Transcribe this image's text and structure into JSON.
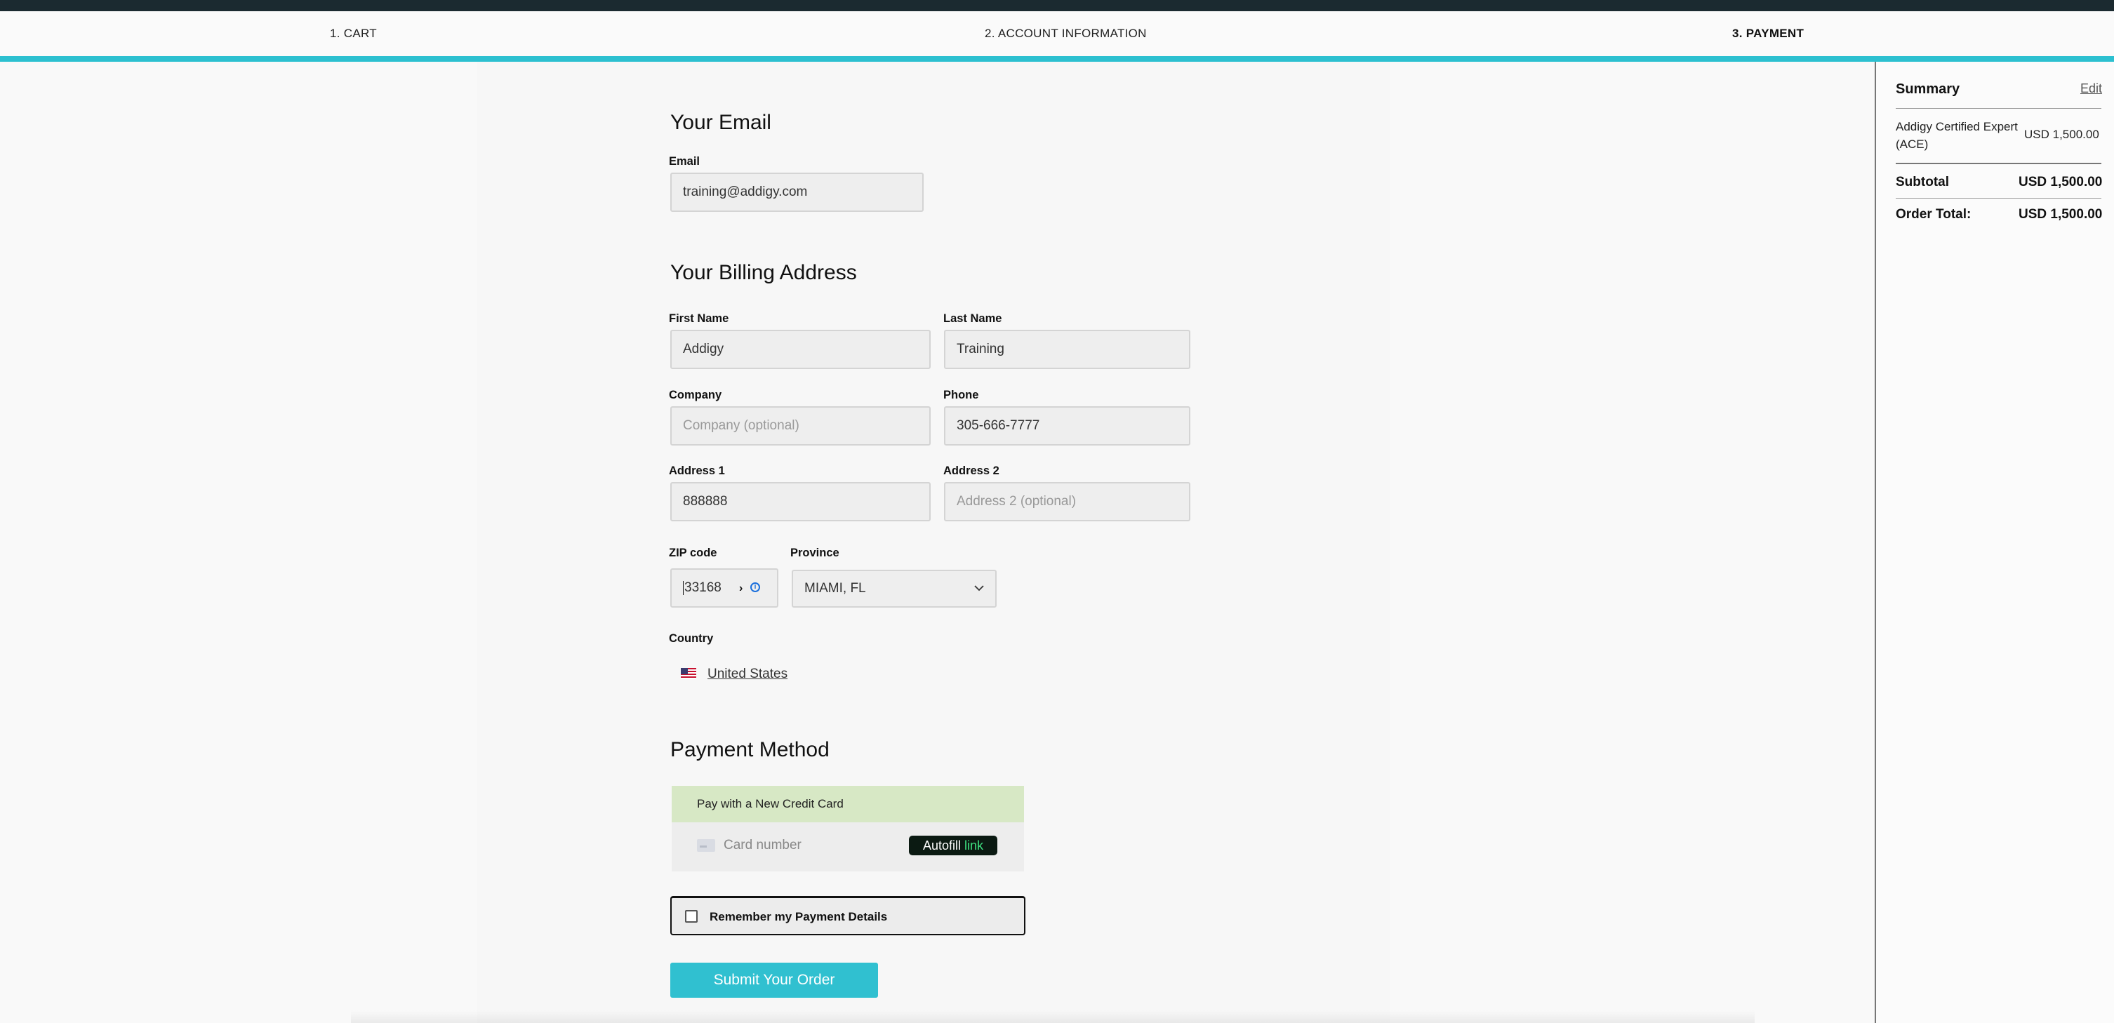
{
  "steps": [
    {
      "label": "1. CART"
    },
    {
      "label": "2. ACCOUNT INFORMATION"
    },
    {
      "label": "3. PAYMENT"
    }
  ],
  "email_section": {
    "title": "Your Email",
    "email_label": "Email",
    "email_value": "training@addigy.com"
  },
  "billing": {
    "title": "Your Billing Address",
    "first_name_label": "First Name",
    "first_name_value": "Addigy",
    "last_name_label": "Last Name",
    "last_name_value": "Training",
    "company_label": "Company",
    "company_placeholder": "Company (optional)",
    "phone_label": "Phone",
    "phone_value": "305-666-7777",
    "address1_label": "Address 1",
    "address1_value": "888888",
    "address2_label": "Address 2",
    "address2_placeholder": "Address 2 (optional)",
    "zip_label": "ZIP code",
    "zip_value": "33168",
    "province_label": "Province",
    "province_value": "MIAMI, FL",
    "country_label": "Country",
    "country_value": "United States"
  },
  "payment": {
    "title": "Payment Method",
    "option_label": "Pay with a New Credit Card",
    "card_placeholder": "Card number",
    "autofill_text": "Autofill",
    "autofill_link": "link",
    "remember_label": "Remember my Payment Details",
    "remember_checked": false,
    "submit_label": "Submit Your Order"
  },
  "summary": {
    "title": "Summary",
    "edit_label": "Edit",
    "item_name": "Addigy Certified Expert (ACE)",
    "item_price": "USD 1,500.00",
    "subtotal_label": "Subtotal",
    "subtotal_value": "USD 1,500.00",
    "total_label": "Order Total:",
    "total_value": "USD 1,500.00"
  },
  "colors": {
    "accent": "#2cc0d0",
    "payment_header": "#d7e8c5",
    "autofill_bg": "#0b1a12",
    "autofill_link": "#3ee080"
  },
  "icons": {
    "zip_autofill": "chevron-right-icon",
    "zip_info": "info-icon",
    "province_dropdown": "chevron-down-icon",
    "country_flag": "us-flag-icon",
    "card": "credit-card-icon"
  }
}
